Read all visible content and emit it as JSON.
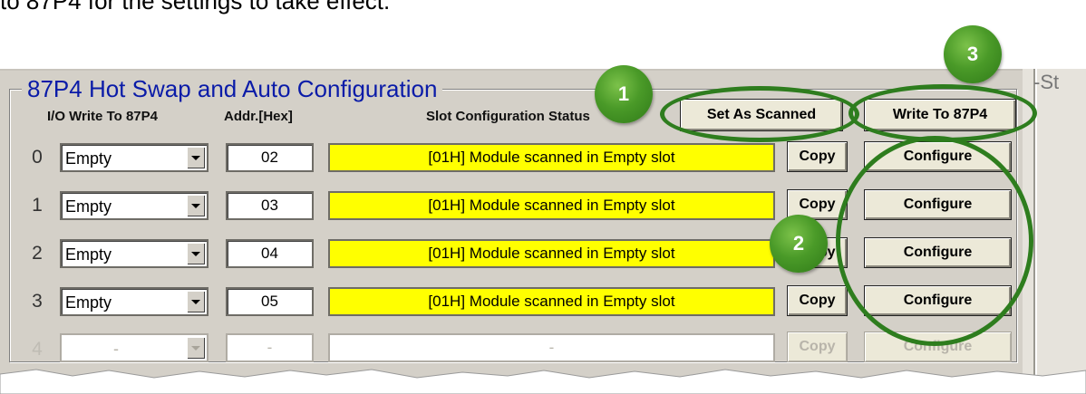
{
  "intro_text": "to 87P4 for the settings to take effect.",
  "group": {
    "title": "87P4 Hot Swap and Auto Configuration",
    "side_label": "-St"
  },
  "headers": {
    "io": "I/O Write To 87P4",
    "addr": "Addr.[Hex]",
    "status": "Slot Configuration Status"
  },
  "buttons": {
    "set_as_scanned": "Set As Scanned",
    "write_to_87p4": "Write To 87P4"
  },
  "rows": [
    {
      "slot": "0",
      "io": "Empty",
      "addr": "02",
      "status": "[01H] Module scanned in Empty slot",
      "copy": "Copy",
      "configure": "Configure",
      "enabled": true
    },
    {
      "slot": "1",
      "io": "Empty",
      "addr": "03",
      "status": "[01H] Module scanned in Empty slot",
      "copy": "Copy",
      "configure": "Configure",
      "enabled": true
    },
    {
      "slot": "2",
      "io": "Empty",
      "addr": "04",
      "status": "[01H] Module scanned in Empty slot",
      "copy": "Copy",
      "configure": "Configure",
      "enabled": true
    },
    {
      "slot": "3",
      "io": "Empty",
      "addr": "05",
      "status": "[01H] Module scanned in Empty slot",
      "copy": "Copy",
      "configure": "Configure",
      "enabled": true
    },
    {
      "slot": "4",
      "io": "-",
      "addr": "-",
      "status": "-",
      "copy": "Copy",
      "configure": "Configure",
      "enabled": false
    }
  ],
  "markers": [
    "1",
    "2",
    "3"
  ],
  "colors": {
    "status_fill": "#ffff00",
    "marker_green": "#4a9a28",
    "title_blue": "#0a1ba8"
  }
}
